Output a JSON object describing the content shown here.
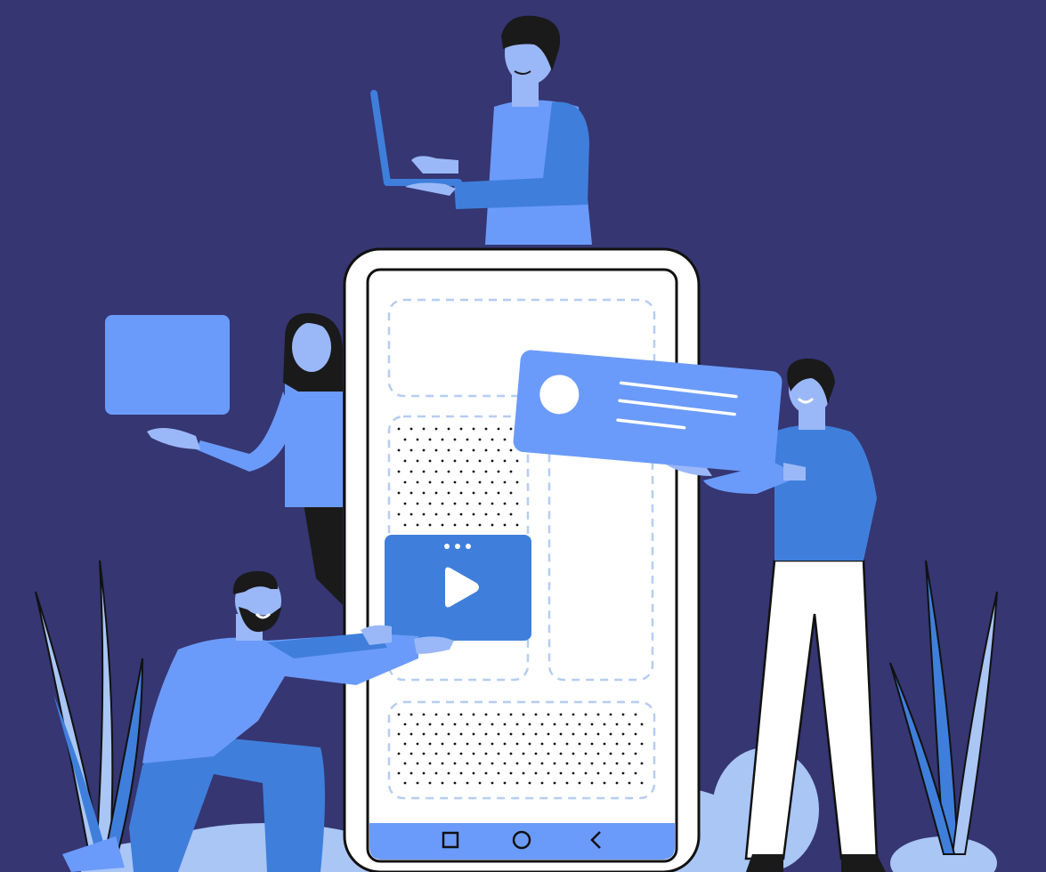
{
  "scene": {
    "description_free": true,
    "colors": {
      "background": "#353672",
      "accent_blue": "#6B9BFA",
      "mid_blue": "#3F7FDB",
      "light_blue": "#A9C6F5",
      "skin": "#9AB8F7",
      "hair": "#1A1A1A",
      "white": "#FFFFFF",
      "outline": "#111111",
      "dashed": "#B5CDF3"
    },
    "phone": {
      "nav_icons": [
        "square-icon",
        "circle-icon",
        "back-chevron-icon"
      ]
    },
    "video_card": {
      "icon": "play-icon",
      "dots": 3
    },
    "profile_card": {
      "icon": "avatar-circle-icon",
      "text_lines": 3
    }
  }
}
